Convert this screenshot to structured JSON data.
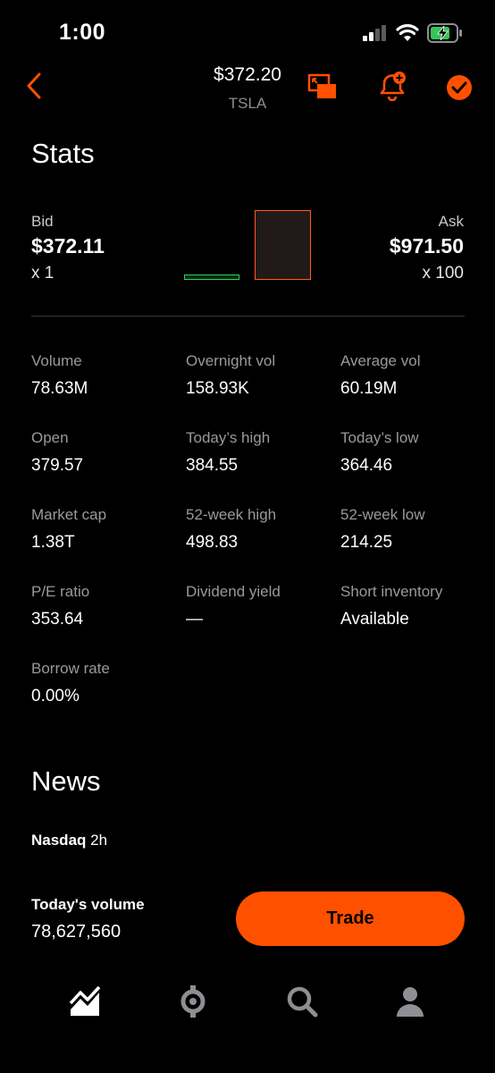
{
  "status_bar": {
    "time": "1:00"
  },
  "header": {
    "price": "$372.20",
    "symbol": "TSLA"
  },
  "stats": {
    "title": "Stats",
    "bid": {
      "label": "Bid",
      "price": "$372.11",
      "size": "x 1"
    },
    "ask": {
      "label": "Ask",
      "price": "$971.50",
      "size": "x 100"
    },
    "items": [
      {
        "label": "Volume",
        "value": "78.63M"
      },
      {
        "label": "Overnight vol",
        "value": "158.93K"
      },
      {
        "label": "Average vol",
        "value": "60.19M"
      },
      {
        "label": "Open",
        "value": "379.57"
      },
      {
        "label": "Today’s high",
        "value": "384.55"
      },
      {
        "label": "Today’s low",
        "value": "364.46"
      },
      {
        "label": "Market cap",
        "value": "1.38T"
      },
      {
        "label": "52-week high",
        "value": "498.83"
      },
      {
        "label": "52-week low",
        "value": "214.25"
      },
      {
        "label": "P/E ratio",
        "value": "353.64"
      },
      {
        "label": "Dividend yield",
        "value": "—"
      },
      {
        "label": "Short inventory",
        "value": "Available"
      },
      {
        "label": "Borrow rate",
        "value": "0.00%"
      }
    ]
  },
  "news": {
    "title": "News",
    "source": "Nasdaq",
    "age": "2h"
  },
  "footer": {
    "volume_label": "Today's volume",
    "volume_value": "78,627,560",
    "trade_label": "Trade"
  },
  "tabs": [
    {
      "icon": "chart-icon",
      "active": true
    },
    {
      "icon": "crypto-icon",
      "active": false
    },
    {
      "icon": "search-icon",
      "active": false
    },
    {
      "icon": "account-icon",
      "active": false
    }
  ],
  "colors": {
    "accent": "#ff5000",
    "bid": "#2fd158",
    "muted": "#9a9a9e"
  }
}
